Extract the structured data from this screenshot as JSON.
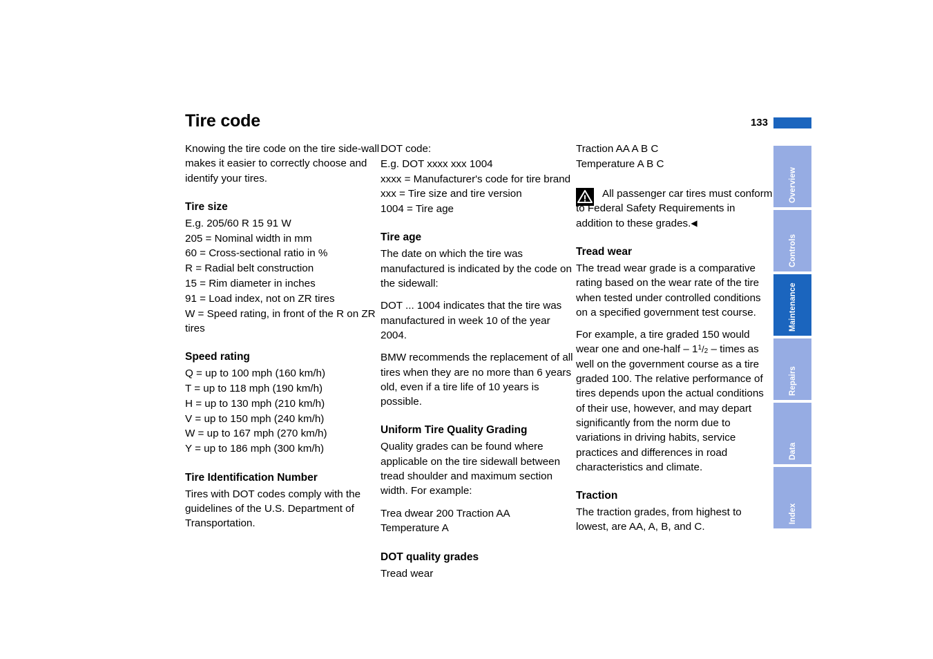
{
  "header": {
    "title": "Tire code",
    "page_number": "133",
    "accent_color": "#1B65BE"
  },
  "columns": {
    "col1": {
      "intro": "Knowing the tire code on the tire side-wall makes it easier to correctly choose and identify your tires.",
      "tire_size_heading": "Tire size",
      "tire_size_lines": [
        "E.g. 205/60 R 15 91 W",
        "205 = Nominal width in mm",
        "60 = Cross-sectional ratio in %",
        "R = Radial belt construction",
        "15 = Rim diameter in inches",
        "91 = Load index, not on ZR tires",
        "W = Speed rating, in front of the R on ZR tires"
      ],
      "speed_rating_heading": "Speed rating",
      "speed_rating_lines": [
        "Q = up to 100 mph (160 km/h)",
        "T = up to 118 mph (190 km/h)",
        "H = up to 130 mph (210 km/h)",
        "V = up to 150 mph (240 km/h)",
        "W = up to 167 mph (270 km/h)",
        "Y = up to 186 mph (300 km/h)"
      ],
      "tin_heading": "Tire Identification Number",
      "tin_body": "Tires with DOT codes comply with the guidelines of the U.S. Department of Transportation."
    },
    "col2": {
      "dot_code_lines": [
        "DOT code:",
        "E.g. DOT xxxx xxx 1004",
        "xxxx = Manufacturer's code for tire brand",
        "xxx = Tire size and tire version",
        "1004 = Tire age"
      ],
      "tire_age_heading": "Tire age",
      "tire_age_p1": "The date on which the tire was manufactured is indicated by the code on the sidewall:",
      "tire_age_p2": "DOT ... 1004 indicates that the tire was manufactured in week 10 of the year 2004.",
      "tire_age_p3": "BMW recommends the replacement of all tires when they are no more than 6 years old, even if a tire life of 10 years is possible.",
      "utqg_heading": "Uniform Tire Quality Grading",
      "utqg_p1": "Quality grades can be found where applicable on the tire sidewall between tread shoulder and maximum section width. For example:",
      "utqg_p2": "Trea dwear 200 Traction AA",
      "utqg_p3": "Temperature A",
      "dot_grades_heading": "DOT quality grades",
      "dot_grades_line": "Tread wear"
    },
    "col3": {
      "grades_lines": [
        "Traction AA A B C",
        "Temperature A B C"
      ],
      "note_text": "All passenger car tires must conform to Federal Safety Requirements in addition to these grades.",
      "note_end_marker": "◀",
      "tread_wear_heading": "Tread wear",
      "tread_wear_p1": "The tread wear grade is a comparative rating based on the wear rate of the tire when tested under controlled conditions on a specified government test course.",
      "tread_wear_p2_a": "For example, a tire graded 150 would wear one and one-half – 1",
      "tread_wear_fraction": {
        "numerator": "1",
        "slash": "/",
        "denominator": "2"
      },
      "tread_wear_p2_b": "– times as well on the government course as a tire graded 100. The relative performance of tires depends upon the actual conditions of their use, however, and may depart significantly from the norm due to variations in driving habits, service practices and differences in road characteristics and climate.",
      "traction_heading": "Traction",
      "traction_body": "The traction grades, from highest to lowest, are AA, A, B, and C."
    }
  },
  "tab_rail": {
    "active_color": "#1B65BE",
    "inactive_color": "#96ACE3",
    "tabs": [
      {
        "label": "Overview",
        "active": false
      },
      {
        "label": "Controls",
        "active": false
      },
      {
        "label": "Maintenance",
        "active": true
      },
      {
        "label": "Repairs",
        "active": false
      },
      {
        "label": "Data",
        "active": false
      },
      {
        "label": "Index",
        "active": false
      }
    ]
  }
}
